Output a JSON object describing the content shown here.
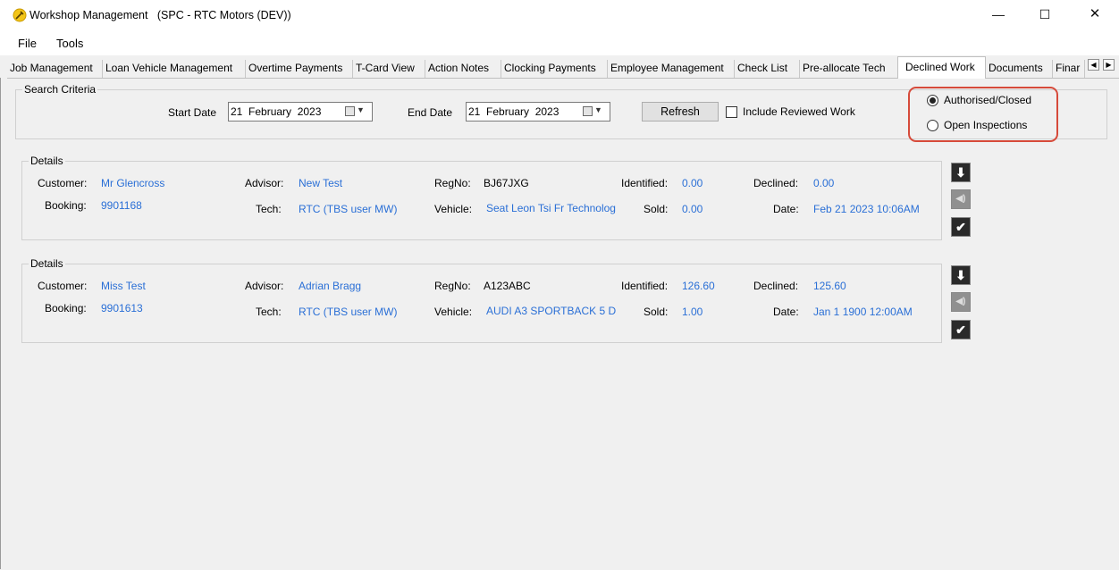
{
  "window": {
    "title": "Workshop Management   (SPC - RTC Motors (DEV))",
    "minimize_glyph": "—",
    "maximize_glyph": "☐",
    "close_glyph": "✕"
  },
  "menu": {
    "items": [
      "File",
      "Tools"
    ]
  },
  "tabs": {
    "items": [
      "Job Management",
      "Loan Vehicle Management",
      "Overtime Payments",
      "T-Card View",
      "Action Notes",
      "Clocking Payments",
      "Employee Management",
      "Check List",
      "Pre-allocate Tech",
      "Declined Work",
      "Documents",
      "Finar"
    ],
    "active": "Declined Work",
    "scroll_left_glyph": "◀",
    "scroll_right_glyph": "▶"
  },
  "search": {
    "group_title": "Search Criteria",
    "start_label": "Start Date",
    "start_value": "21  February  2023",
    "end_label": "End Date",
    "end_value": "21  February  2023",
    "refresh_label": "Refresh",
    "include_reviewed_label": "Include Reviewed Work",
    "include_reviewed_checked": false,
    "radio_authorised_label": "Authorised/Closed",
    "radio_open_label": "Open Inspections",
    "selected": "Authorised/Closed"
  },
  "field_labels": {
    "customer": "Customer:",
    "booking": "Booking:",
    "advisor": "Advisor:",
    "tech": "Tech:",
    "regno": "RegNo:",
    "vehicle": "Vehicle:",
    "identified": "Identified:",
    "sold": "Sold:",
    "declined": "Declined:",
    "date": "Date:"
  },
  "cards": [
    {
      "title": "Details",
      "customer": "Mr Glencross",
      "booking": "9901168",
      "advisor": "New Test",
      "tech": "RTC (TBS user MW)",
      "regno": "BJ67JXG",
      "vehicle": "Seat Leon Tsi Fr Technolog",
      "identified": "0.00",
      "sold": "0.00",
      "declined": "0.00",
      "date": "Feb 21 2023 10:06AM"
    },
    {
      "title": "Details",
      "customer": "Miss Test",
      "booking": "9901613",
      "advisor": "Adrian Bragg",
      "tech": "RTC (TBS user MW)",
      "regno": "A123ABC",
      "vehicle": "AUDI A3 SPORTBACK 5 D",
      "identified": "126.60",
      "sold": "1.00",
      "declined": "125.60",
      "date": "Jan  1 1900 12:00AM"
    }
  ],
  "card_actions": {
    "down_glyph": "⬇",
    "sound_glyph": "◀)",
    "check_glyph": "✔"
  },
  "colors": {
    "link": "#2a6fd6",
    "highlight_border": "#d64a3a",
    "app_icon": "#f0c419"
  }
}
